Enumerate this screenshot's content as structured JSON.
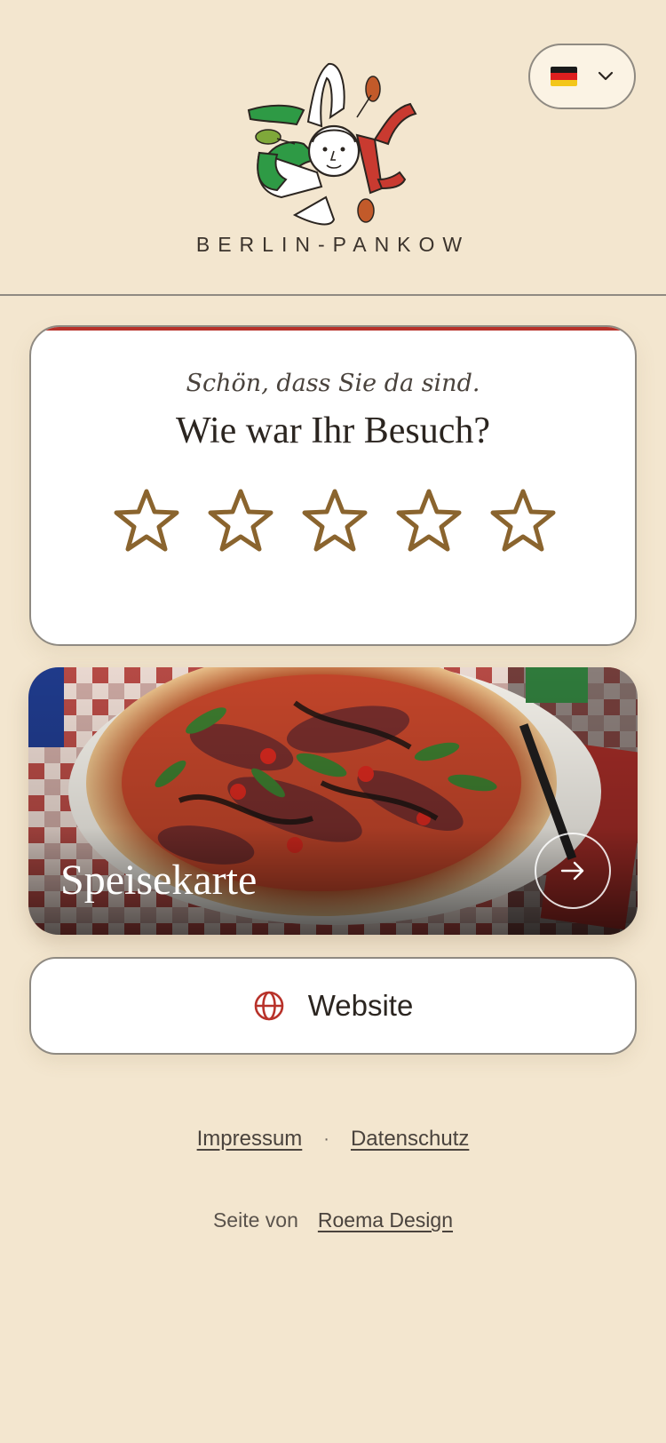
{
  "header": {
    "language": {
      "flag": "german-flag-icon",
      "selected": "Deutsch"
    },
    "subtitle": "BERLIN-PANKOW"
  },
  "rating": {
    "greeting": "Schön, dass Sie da sind.",
    "question": "Wie war Ihr Besuch?",
    "stars_total": 5,
    "stars_selected": 0
  },
  "menu_card": {
    "title": "Speisekarte"
  },
  "website_button": {
    "label": "Website"
  },
  "footer": {
    "impressum": "Impressum",
    "separator": "·",
    "datenschutz": "Datenschutz",
    "credit_prefix": "Seite von",
    "credit_link": "Roema Design"
  },
  "colors": {
    "background": "#f3e6cf",
    "accent_red": "#b8322a",
    "star_brown": "#8a642e",
    "border": "#8f8a82"
  }
}
